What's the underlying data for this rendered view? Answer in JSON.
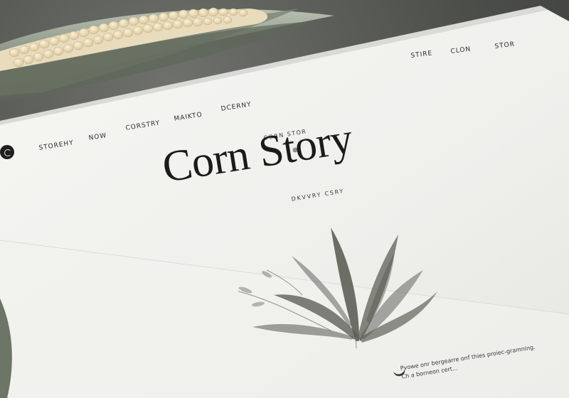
{
  "top_nav": [
    "STIRE",
    "CLON",
    "STOR"
  ],
  "main_nav": [
    "STOREHY",
    "NOW",
    "CORSTRY",
    "MAIKTO",
    "DCERNY"
  ],
  "hero": {
    "kicker": "CORN STOR",
    "title": "Corn Story",
    "subtitle": "DKVVRY CSRY"
  },
  "footer_text": {
    "line1": "Pvowe onr bergearre onf thies proiec-gramning.",
    "line2": "Ch a borneon cert..."
  },
  "colors": {
    "paper": "#f2f2ef",
    "ink": "#1b1b1b",
    "leaf": "#55574f",
    "background": "#4c4e4a"
  },
  "icons": [
    "logo-icon",
    "plant-illustration",
    "moon-icon",
    "corn-cob"
  ]
}
